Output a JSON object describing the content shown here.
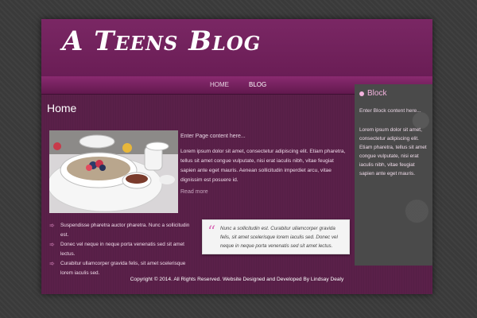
{
  "header": {
    "logo": "A Teens Blog"
  },
  "nav": {
    "items": [
      {
        "label": "HOME",
        "active": false
      },
      {
        "label": "BLOG",
        "active": true
      }
    ]
  },
  "main": {
    "title": "Home",
    "photo_icon": "breakfast-photo",
    "intro_heading": "Enter Page content here...",
    "intro_body": "Lorem ipsum dolor sit amet, consectetur adipiscing elit. Etiam pharetra, tellus sit amet congue vulputate, nisi erat iaculis nibh, vitae feugiat sapien ante eget mauris. Aenean sollicitudin imperdiet arcu, vitae dignissim est posuere id.",
    "read_more": "Read more",
    "bullets": [
      "Suspendisse pharetra auctor pharetra. Nunc a sollicitudin est.",
      "Donec vel neque in neque porta venenatis sed sit amet lectus.",
      "Curabitur ullamcorper gravida felis, sit amet scelerisque lorem iaculis sed."
    ],
    "quote": "Nunc a sollicitudin est. Curabitur ullamcorper gravida felis, sit amet scelerisque lorem iaculis sed. Donec vel neque in neque porta venenatis sed sit amet lectus."
  },
  "sidebar": {
    "title": "Block",
    "heading": "Enter Block content here...",
    "body": "Lorem ipsum dolor sit amet, consectetur adipiscing elit. Etiam pharetra, tellus sit amet congue vulputate, nisi erat iaculis nibh, vitae feugiat sapien ante eget mauris."
  },
  "footer": {
    "text": "Copyright © 2014. All Rights Reserved. Website Designed and Developed By Lindsay Dealy"
  },
  "colors": {
    "page_bg": "#3a3a3a",
    "site_bg": "#5a2049",
    "accent_pink": "#f2b3dd",
    "sidebar_bg": "#4a4a4a"
  }
}
